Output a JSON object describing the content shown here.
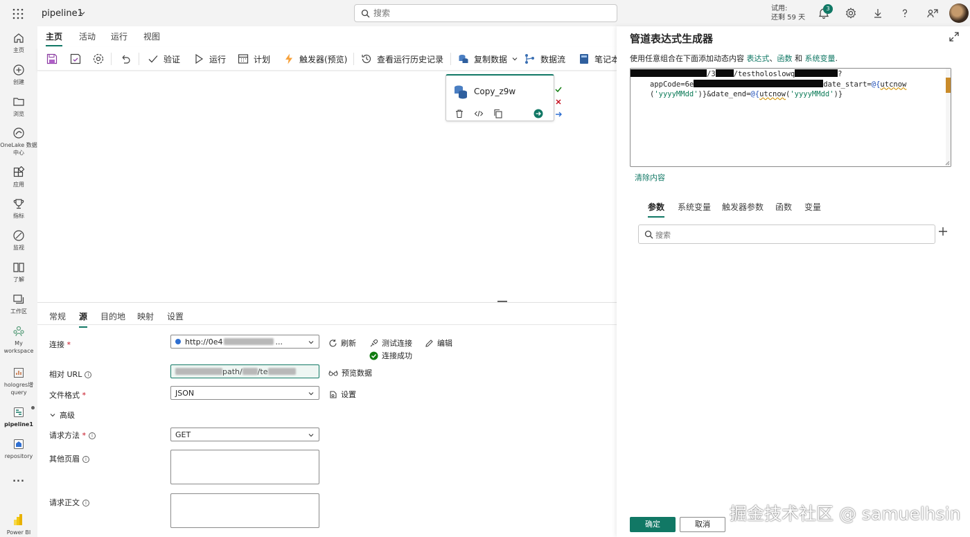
{
  "topbar": {
    "app_name": "pipeline1",
    "search_placeholder": "搜索",
    "trial_line1": "试用:",
    "trial_line2": "还剩 59 天",
    "notification_count": "3"
  },
  "rail": {
    "items": [
      {
        "label": "主页",
        "icon": "home-icon"
      },
      {
        "label": "创建",
        "icon": "plus-circle-icon"
      },
      {
        "label": "浏览",
        "icon": "folder-icon"
      },
      {
        "label": "OneLake 数据中心",
        "icon": "onelake-icon"
      },
      {
        "label": "应用",
        "icon": "apps-icon"
      },
      {
        "label": "指标",
        "icon": "trophy-icon"
      },
      {
        "label": "监视",
        "icon": "monitor-icon"
      },
      {
        "label": "了解",
        "icon": "book-icon"
      },
      {
        "label": "工作区",
        "icon": "workspaces-icon"
      },
      {
        "label": "My workspace",
        "icon": "people-icon"
      },
      {
        "label": "hologres增query",
        "icon": "report-icon"
      },
      {
        "label": "pipeline1",
        "icon": "pipeline-icon"
      },
      {
        "label": "repository",
        "icon": "repository-icon"
      },
      {
        "label": "...",
        "icon": "more-icon"
      },
      {
        "label": "Power BI",
        "icon": "powerbi-icon"
      }
    ]
  },
  "menu": {
    "tabs": [
      "主页",
      "活动",
      "运行",
      "视图"
    ],
    "active_tab": "主页"
  },
  "toolbar": {
    "validate": "验证",
    "run": "运行",
    "schedule": "计划",
    "trigger": "触发器(预览)",
    "history": "查看运行历史记录",
    "copy_data": "复制数据",
    "dataflow": "数据流",
    "notebook": "笔记本"
  },
  "canvas": {
    "activity_name": "Copy_z9w"
  },
  "bottom": {
    "tabs": [
      "常规",
      "源",
      "目的地",
      "映射",
      "设置"
    ],
    "active_tab": "源",
    "connection_label": "连接",
    "connection_value": "http://0e4",
    "connection_suffix": "...",
    "refresh": "刷新",
    "test_connection": "测试连接",
    "edit": "编辑",
    "connection_success": "连接成功",
    "relative_url_label": "相对 URL",
    "relative_url_value_mid": "path/",
    "relative_url_value_end": "/te",
    "preview_data": "预览数据",
    "file_format_label": "文件格式",
    "file_format_value": "JSON",
    "settings": "设置",
    "advanced": "高级",
    "request_method_label": "请求方法",
    "request_method_value": "GET",
    "additional_headers_label": "其他页眉",
    "request_body_label": "请求正文"
  },
  "panel": {
    "title": "管道表达式生成器",
    "description": "使用任意组合在下面添加动态内容",
    "desc_link1": "表达式",
    "desc_sep": "、",
    "desc_link2": "函数",
    "desc_and": " 和 ",
    "desc_link3": "系统变量",
    "desc_end": ".",
    "expr": {
      "line1_a": "/3",
      "line1_b": "/testholoslowq",
      "line1_c": "?",
      "line2_a": "appCode=6e",
      "line2_b": "date_start=",
      "line2_c": "@{",
      "line2_d": "utcnow",
      "line3_a": "(",
      "line3_b": "'yyyyMMdd'",
      "line3_c": ")}&date_end=",
      "line3_d": "@{",
      "line3_e": "utcnow",
      "line3_f": "(",
      "line3_g": "'yyyyMMdd'",
      "line3_h": ")}"
    },
    "clear": "清除内容",
    "tabs": [
      "参数",
      "系统变量",
      "触发器参数",
      "函数",
      "变量"
    ],
    "active_tab": "参数",
    "search_placeholder": "搜索",
    "ok": "确定",
    "cancel": "取消"
  },
  "watermark": "掘金技术社区 @ samuelhsin",
  "colors": {
    "accent": "#117865",
    "background": "#f3f3f3",
    "error": "#c50f1f",
    "success": "#107c10"
  }
}
